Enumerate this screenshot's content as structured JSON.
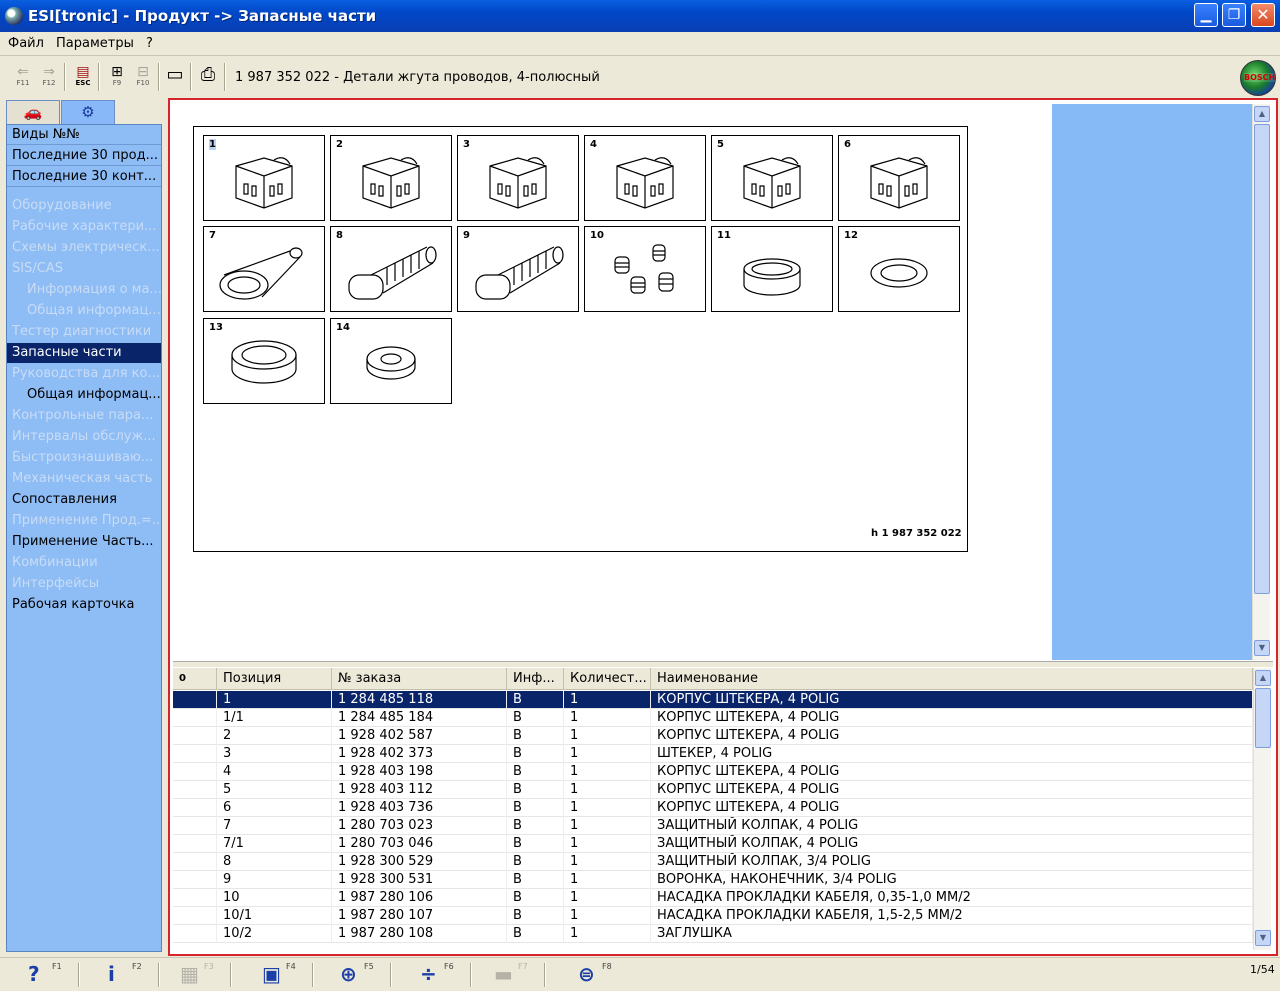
{
  "window": {
    "title": "ESI[tronic] - Продукт -> Запасные части",
    "min_glyph": "▁",
    "max_glyph": "❐",
    "close_glyph": "✕"
  },
  "menu": [
    "Файл",
    "Параметры",
    "?"
  ],
  "toolbar": {
    "back_key": "F11",
    "forward_key": "F12",
    "esc_key": "ESC",
    "f9_key": "F9",
    "f10_key": "F10",
    "back_glyph": "⇐",
    "forward_glyph": "⇒",
    "esc_glyph": "▤",
    "f9_glyph": "⊞",
    "f10_glyph": "⊟",
    "doc_glyph": "▭",
    "print_glyph": "⎙",
    "product_title": "1 987 352 022 - Детали жгута проводов, 4-полюсный",
    "logo_text": "BOSCH"
  },
  "tabs": [
    {
      "name": "vehicle-tab",
      "glyph": "🚗"
    },
    {
      "name": "parts-tab",
      "glyph": "⚙"
    }
  ],
  "nav": [
    {
      "label": "Виды №№",
      "state": "top"
    },
    {
      "label": "Последние 30 прод...",
      "state": "top"
    },
    {
      "label": "Последние 30 конт...",
      "state": "top"
    },
    {
      "label": "Оборудование",
      "state": "dim"
    },
    {
      "label": "Рабочие характери...",
      "state": "dim"
    },
    {
      "label": "Схемы электрическ...",
      "state": "dim"
    },
    {
      "label": "SIS/CAS",
      "state": "dim"
    },
    {
      "label": "Информация о ма...",
      "state": "dim-sub"
    },
    {
      "label": "Общая информац...",
      "state": "dim-sub"
    },
    {
      "label": "Тестер диагностики",
      "state": "dim"
    },
    {
      "label": "Запасные части",
      "state": "sel"
    },
    {
      "label": "Руководства для ко...",
      "state": "dim"
    },
    {
      "label": "Общая информац...",
      "state": "sub"
    },
    {
      "label": "Контрольные пара...",
      "state": "dim"
    },
    {
      "label": "Интервалы обслуж...",
      "state": "dim"
    },
    {
      "label": "Быстроизнашиваю...",
      "state": "dim"
    },
    {
      "label": "Механическая часть",
      "state": "dim"
    },
    {
      "label": "Сопоставления",
      "state": "normal"
    },
    {
      "label": "Применение Прод.=...",
      "state": "dim"
    },
    {
      "label": "Применение Часть...",
      "state": "normal"
    },
    {
      "label": "Комбинации",
      "state": "dim"
    },
    {
      "label": "Интерфейсы",
      "state": "dim"
    },
    {
      "label": "Рабочая карточка",
      "state": "normal"
    }
  ],
  "drawing": {
    "cells": [
      "1",
      "2",
      "3",
      "4",
      "5",
      "6",
      "7",
      "8",
      "9",
      "10",
      "11",
      "12",
      "13",
      "14"
    ],
    "reference": "h 1 987 352 022"
  },
  "table": {
    "columns": [
      "0",
      "Позиция",
      "№ заказа",
      "Инф...",
      "Количест...",
      "Наименование"
    ],
    "rows": [
      [
        "",
        "1",
        "1 284 485 118",
        "B",
        "1",
        "КОРПУС ШТЕКЕРА,   4 POLIG"
      ],
      [
        "",
        "1/1",
        "1 284 485 184",
        "B",
        "1",
        "КОРПУС ШТЕКЕРА,   4 POLIG"
      ],
      [
        "",
        "2",
        "1 928 402 587",
        "B",
        "1",
        "КОРПУС ШТЕКЕРА,   4 POLIG"
      ],
      [
        "",
        "3",
        "1 928 402 373",
        "B",
        "1",
        "ШТЕКЕР,   4 POLIG"
      ],
      [
        "",
        "4",
        "1 928 403 198",
        "B",
        "1",
        "КОРПУС ШТЕКЕРА,   4 POLIG"
      ],
      [
        "",
        "5",
        "1 928 403 112",
        "B",
        "1",
        "КОРПУС ШТЕКЕРА,   4 POLIG"
      ],
      [
        "",
        "6",
        "1 928 403 736",
        "B",
        "1",
        "КОРПУС ШТЕКЕРА,   4 POLIG"
      ],
      [
        "",
        "7",
        "1 280 703 023",
        "B",
        "1",
        "ЗАЩИТНЫЙ КОЛПАК,   4 POLIG"
      ],
      [
        "",
        "7/1",
        "1 280 703 046",
        "B",
        "1",
        "ЗАЩИТНЫЙ КОЛПАК,   4 POLIG"
      ],
      [
        "",
        "8",
        "1 928 300 529",
        "B",
        "1",
        "ЗАЩИТНЫЙ КОЛПАК,   3/4 POLIG"
      ],
      [
        "",
        "9",
        "1 928 300 531",
        "B",
        "1",
        "ВОРОНКА, НАКОНЕЧНИК,   3/4 POLIG"
      ],
      [
        "",
        "10",
        "1 987 280 106",
        "B",
        "1",
        "НАСАДКА ПРОКЛАДКИ КАБЕЛЯ,   0,35-1,0 MM/2"
      ],
      [
        "",
        "10/1",
        "1 987 280 107",
        "B",
        "1",
        "НАСАДКА ПРОКЛАДКИ КАБЕЛЯ,   1,5-2,5 MM/2"
      ],
      [
        "",
        "10/2",
        "1 987 280 108",
        "B",
        "1",
        "ЗАГЛУШКА"
      ]
    ],
    "selected_index": 0
  },
  "fkeys": [
    {
      "name": "help",
      "glyph": "?",
      "key": "F1",
      "enabled": true
    },
    {
      "name": "info",
      "glyph": "i",
      "key": "F2",
      "enabled": true
    },
    {
      "name": "f3",
      "glyph": "▦",
      "key": "F3",
      "enabled": false
    },
    {
      "name": "f4",
      "glyph": "▣",
      "key": "F4",
      "enabled": true
    },
    {
      "name": "zoom",
      "glyph": "⊕",
      "key": "F5",
      "enabled": true
    },
    {
      "name": "split",
      "glyph": "÷",
      "key": "F6",
      "enabled": true
    },
    {
      "name": "f7",
      "glyph": "▬",
      "key": "F7",
      "enabled": false
    },
    {
      "name": "f8",
      "glyph": "⊜",
      "key": "F8",
      "enabled": true
    }
  ],
  "status": {
    "page": "1/54"
  }
}
